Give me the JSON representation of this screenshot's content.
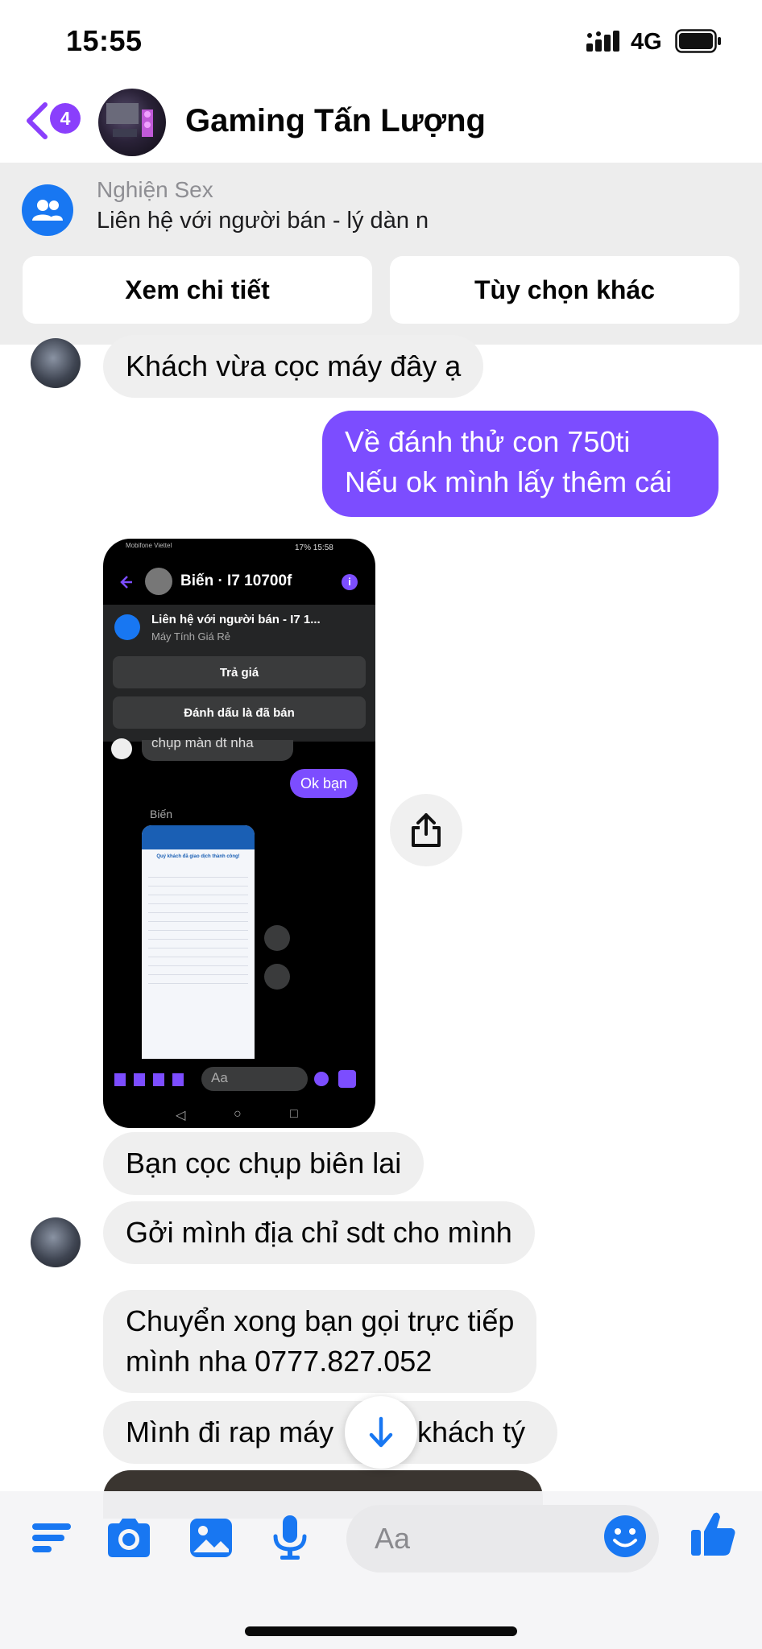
{
  "status_bar": {
    "time": "15:55",
    "network": "4G"
  },
  "header": {
    "back_badge": "4",
    "contact_name": "Gaming Tấn Lượng"
  },
  "listing": {
    "category": "Nghiện Sex",
    "title": "Liên hệ với người bán - lý dàn n",
    "details_button": "Xem chi tiết",
    "options_button": "Tùy chọn khác"
  },
  "messages": [
    {
      "side": "in",
      "text": "Khách vừa cọc máy đây ạ"
    },
    {
      "side": "out",
      "lines": [
        "Về đánh thử con 750ti",
        "Nếu ok mình lấy thêm cái"
      ]
    },
    {
      "side": "in",
      "text": "Bạn cọc chụp biên lai"
    },
    {
      "side": "in",
      "text": "Gởi mình địa chỉ sdt cho mình"
    },
    {
      "side": "in",
      "lines": [
        "Chuyển xong bạn gọi trực tiếp",
        "mình nha 0777.827.052"
      ]
    },
    {
      "side": "in",
      "text_left": "Mình đi rap máy",
      "text_right": "khách tý"
    }
  ],
  "shared_screenshot": {
    "status_carrier": "Mobifone Viettel",
    "status_right": "17% 15:58",
    "contact_name": "Biến · I7 10700f",
    "listing_title": "Liên hệ với người bán - I7 1...",
    "listing_subtitle": "Máy Tính Giá Rẻ",
    "offer_button": "Trả giá",
    "mark_sold_button": "Đánh dấu là đã bán",
    "partial_message": "chụp màn dt nha",
    "sent_message": "Ok bạn",
    "sender_label": "Biến",
    "receipt_title": "Quý khách đã giao dịch thành công!",
    "composer_placeholder": "Aa"
  },
  "composer": {
    "placeholder": "Aa"
  },
  "colors": {
    "accent": "#7c4dff",
    "messenger_blue": "#1877f2",
    "incoming_bubble": "#efefef"
  }
}
